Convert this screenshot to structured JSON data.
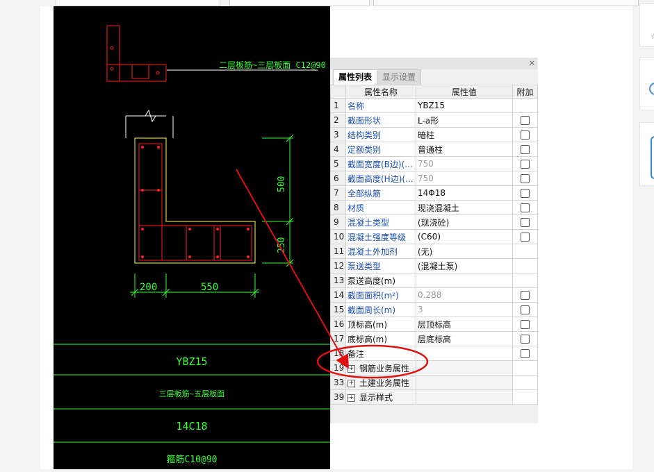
{
  "cad": {
    "top_label": "二层板筋~三层板面 C12@90",
    "dim_vertical_top": "500",
    "dim_vertical_bottom": "250",
    "dim_horizontal_left": "200",
    "dim_horizontal_right": "550",
    "rows": [
      {
        "text": "YBZ15"
      },
      {
        "text": "三层板筋~五层板面"
      },
      {
        "text": "14C18"
      },
      {
        "text": "箍筋C10@90"
      }
    ]
  },
  "panel": {
    "close": "×",
    "tabs": [
      "属性列表",
      "显示设置"
    ],
    "columns": [
      "属性名称",
      "属性值",
      "附加"
    ],
    "rows": [
      {
        "num": "1",
        "name": "名称",
        "value": "YBZ15",
        "link": true,
        "gray": false,
        "checkbox": false
      },
      {
        "num": "2",
        "name": "截面形状",
        "value": "L-a形",
        "link": true,
        "gray": false,
        "checkbox": true
      },
      {
        "num": "3",
        "name": "结构类别",
        "value": "暗柱",
        "link": true,
        "gray": false,
        "checkbox": true
      },
      {
        "num": "4",
        "name": "定额类别",
        "value": "普通柱",
        "link": true,
        "gray": false,
        "checkbox": true
      },
      {
        "num": "5",
        "name": "截面宽度(B边)(...",
        "value": "750",
        "link": true,
        "gray": true,
        "checkbox": true
      },
      {
        "num": "6",
        "name": "截面高度(H边)(...",
        "value": "750",
        "link": true,
        "gray": true,
        "checkbox": true
      },
      {
        "num": "7",
        "name": "全部纵筋",
        "value": "14Φ18",
        "link": true,
        "gray": false,
        "checkbox": true
      },
      {
        "num": "8",
        "name": "材质",
        "value": "现浇混凝土",
        "link": true,
        "gray": false,
        "checkbox": true
      },
      {
        "num": "9",
        "name": "混凝土类型",
        "value": "(现浇砼)",
        "link": true,
        "gray": false,
        "checkbox": true
      },
      {
        "num": "10",
        "name": "混凝土强度等级",
        "value": "(C60)",
        "link": true,
        "gray": false,
        "checkbox": true
      },
      {
        "num": "11",
        "name": "混凝土外加剂",
        "value": "(无)",
        "link": true,
        "gray": false,
        "checkbox": false
      },
      {
        "num": "12",
        "name": "泵送类型",
        "value": "(混凝土泵)",
        "link": true,
        "gray": false,
        "checkbox": false
      },
      {
        "num": "13",
        "name": "泵送高度(m)",
        "value": "",
        "link": false,
        "gray": false,
        "checkbox": false
      },
      {
        "num": "14",
        "name": "截面面积(m²)",
        "value": "0.288",
        "link": true,
        "gray": true,
        "checkbox": true
      },
      {
        "num": "15",
        "name": "截面周长(m)",
        "value": "3",
        "link": true,
        "gray": true,
        "checkbox": true
      },
      {
        "num": "16",
        "name": "顶标高(m)",
        "value": "层顶标高",
        "link": false,
        "gray": false,
        "checkbox": true
      },
      {
        "num": "17",
        "name": "底标高(m)",
        "value": "层底标高",
        "link": false,
        "gray": false,
        "checkbox": true
      },
      {
        "num": "18",
        "name": "备注",
        "value": "",
        "link": false,
        "gray": false,
        "checkbox": true
      }
    ],
    "groups": [
      {
        "num": "19",
        "name": "钢筋业务属性",
        "expand": "+"
      },
      {
        "num": "33",
        "name": "土建业务属性",
        "expand": "+"
      },
      {
        "num": "39",
        "name": "显示样式",
        "expand": "+"
      }
    ]
  },
  "colors": {
    "cad_bg": "#000000",
    "rebar_red": "#ff2020",
    "dim_green": "#33ff33",
    "outline_yellow": "#ffff66",
    "annotation_red": "#e01010",
    "link_blue": "#1a4fb5"
  }
}
